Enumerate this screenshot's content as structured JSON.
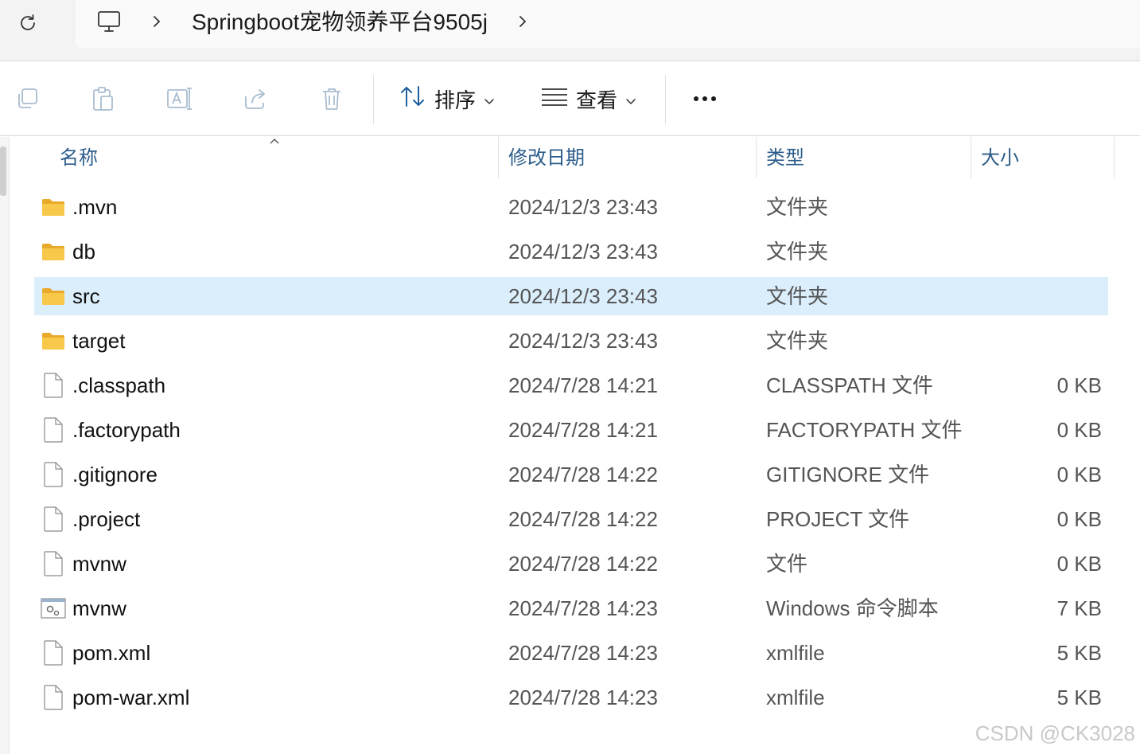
{
  "address_bar": {
    "refresh_icon": "refresh-icon",
    "pc_icon": "monitor-icon",
    "breadcrumb": "Springboot宠物领养平台9505j"
  },
  "toolbar": {
    "sort_label": "排序",
    "view_label": "查看"
  },
  "columns": {
    "name": "名称",
    "modified": "修改日期",
    "type": "类型",
    "size": "大小"
  },
  "files": [
    {
      "name": ".mvn",
      "modified": "2024/12/3 23:43",
      "type": "文件夹",
      "size": "",
      "icon": "folder-icon"
    },
    {
      "name": "db",
      "modified": "2024/12/3 23:43",
      "type": "文件夹",
      "size": "",
      "icon": "folder-icon"
    },
    {
      "name": "src",
      "modified": "2024/12/3 23:43",
      "type": "文件夹",
      "size": "",
      "icon": "folder-icon",
      "selected": true
    },
    {
      "name": "target",
      "modified": "2024/12/3 23:43",
      "type": "文件夹",
      "size": "",
      "icon": "folder-icon"
    },
    {
      "name": ".classpath",
      "modified": "2024/7/28 14:21",
      "type": "CLASSPATH 文件",
      "size": "0 KB",
      "icon": "file-icon"
    },
    {
      "name": ".factorypath",
      "modified": "2024/7/28 14:21",
      "type": "FACTORYPATH 文件",
      "size": "0 KB",
      "icon": "file-icon"
    },
    {
      "name": ".gitignore",
      "modified": "2024/7/28 14:22",
      "type": "GITIGNORE 文件",
      "size": "0 KB",
      "icon": "file-icon"
    },
    {
      "name": ".project",
      "modified": "2024/7/28 14:22",
      "type": "PROJECT 文件",
      "size": "0 KB",
      "icon": "file-icon"
    },
    {
      "name": "mvnw",
      "modified": "2024/7/28 14:22",
      "type": "文件",
      "size": "0 KB",
      "icon": "file-icon"
    },
    {
      "name": "mvnw",
      "modified": "2024/7/28 14:23",
      "type": "Windows 命令脚本",
      "size": "7 KB",
      "icon": "script-icon"
    },
    {
      "name": "pom.xml",
      "modified": "2024/7/28 14:23",
      "type": "xmlfile",
      "size": "5 KB",
      "icon": "file-icon"
    },
    {
      "name": "pom-war.xml",
      "modified": "2024/7/28 14:23",
      "type": "xmlfile",
      "size": "5 KB",
      "icon": "file-icon"
    }
  ],
  "watermark": "CSDN @CK3028",
  "colors": {
    "selected_row": "#dbeefc",
    "header_text": "#2b5c8a",
    "folder_yellow": "#f8c84a"
  }
}
